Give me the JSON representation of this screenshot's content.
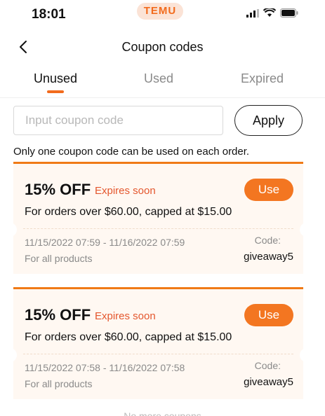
{
  "status_bar": {
    "time": "18:01",
    "app_badge": "TEMU"
  },
  "nav": {
    "title": "Coupon codes"
  },
  "tabs": [
    {
      "label": "Unused",
      "active": true
    },
    {
      "label": "Used",
      "active": false
    },
    {
      "label": "Expired",
      "active": false
    }
  ],
  "coupon_input": {
    "placeholder": "Input coupon code",
    "value": ""
  },
  "apply_label": "Apply",
  "notice": "Only one coupon code can be used on each order.",
  "coupons": [
    {
      "discount": "15% OFF",
      "expires": "Expires soon",
      "use_label": "Use",
      "condition": "For orders over $60.00, capped at $15.00",
      "validity": "11/15/2022 07:59 - 11/16/2022 07:59",
      "scope": "For all products",
      "code_label": "Code:",
      "code": "giveaway5"
    },
    {
      "discount": "15% OFF",
      "expires": "Expires soon",
      "use_label": "Use",
      "condition": "For orders over $60.00, capped at $15.00",
      "validity": "11/15/2022 07:58 - 11/16/2022 07:58",
      "scope": "For all products",
      "code_label": "Code:",
      "code": "giveaway5"
    }
  ],
  "footer": "No more coupons",
  "colors": {
    "accent": "#f37621",
    "expires": "#e4572e",
    "card_bg": "#fff8f2"
  }
}
